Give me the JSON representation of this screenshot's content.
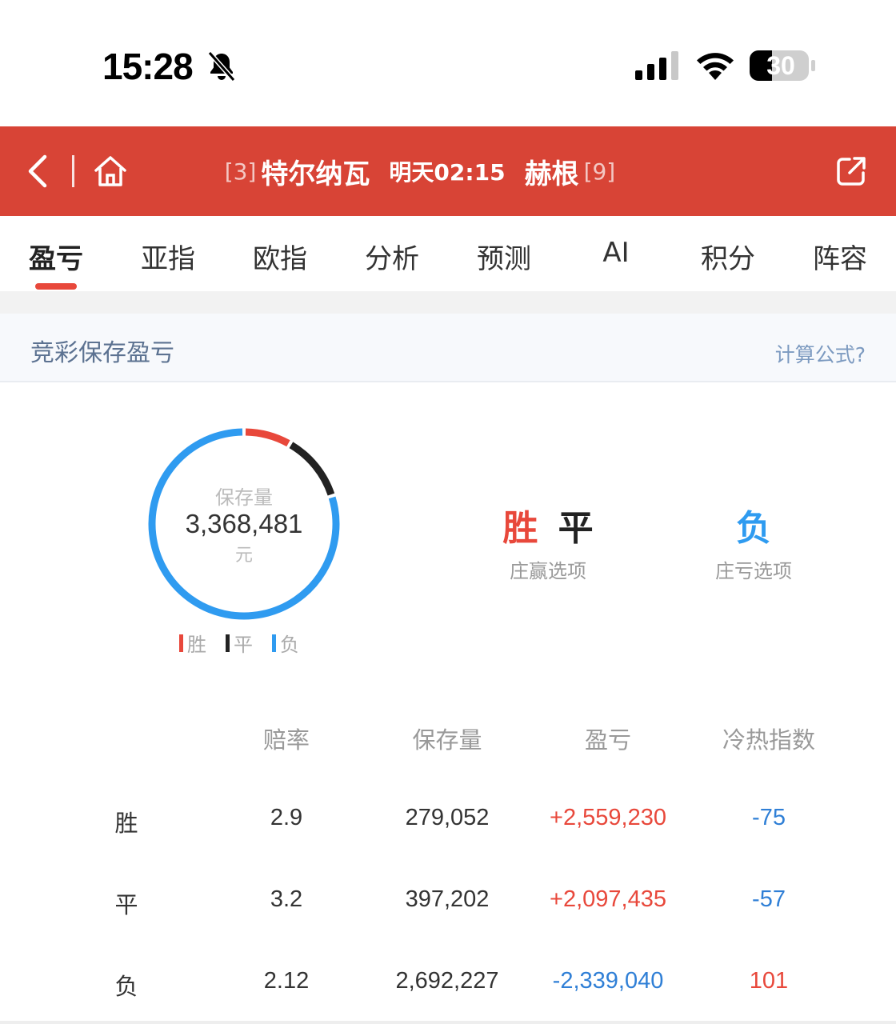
{
  "status": {
    "time": "15:28",
    "battery": "30"
  },
  "header": {
    "home_rank": "[3]",
    "home_team": "特尔纳瓦",
    "kickoff": "明天02:15",
    "away_team": "赫根",
    "away_rank": "[9]"
  },
  "tabs": [
    "盈亏",
    "亚指",
    "欧指",
    "分析",
    "预测",
    "AI",
    "积分",
    "阵容"
  ],
  "section": {
    "title": "竞彩保存盈亏",
    "formula_link": "计算公式?"
  },
  "summary": {
    "label": "保存量",
    "total": "3,368,481",
    "unit": "元",
    "legend": [
      "胜",
      "平",
      "负"
    ]
  },
  "outcomes": {
    "win_label": "胜",
    "draw_label": "平",
    "house_win_caption": "庄赢选项",
    "loss_label": "负",
    "house_loss_caption": "庄亏选项"
  },
  "colors": {
    "win": "#e8483b",
    "draw": "#222222",
    "loss": "#2f9bf0",
    "header": "#d84436"
  },
  "table": {
    "headers": [
      "赔率",
      "保存量",
      "盈亏",
      "冷热指数"
    ],
    "rows": [
      {
        "label": "胜",
        "odds": "2.9",
        "stake": "279,052",
        "pnl": "+2,559,230",
        "heat": "-75"
      },
      {
        "label": "平",
        "odds": "3.2",
        "stake": "397,202",
        "pnl": "+2,097,435",
        "heat": "-57"
      },
      {
        "label": "负",
        "odds": "2.12",
        "stake": "2,692,227",
        "pnl": "-2,339,040",
        "heat": "101"
      }
    ]
  },
  "chart_data": {
    "type": "pie",
    "categories": [
      "胜",
      "平",
      "负"
    ],
    "values": [
      279052,
      397202,
      2692227
    ]
  }
}
